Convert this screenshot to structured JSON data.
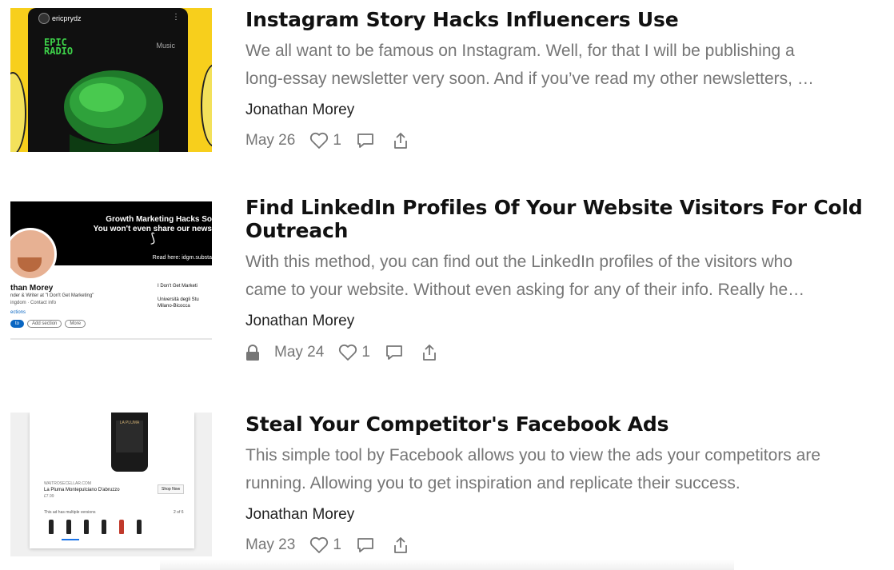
{
  "posts": [
    {
      "title": "Instagram Story Hacks Influencers Use",
      "excerpt_lines": [
        "We all want to be famous on Instagram. Well, for that I will be publishing a",
        "long-essay newsletter very soon. And if you’ve read my other newsletters, …"
      ],
      "author": "Jonathan Morey",
      "date": "May 26",
      "likes": "1",
      "locked": false,
      "thumbnail": {
        "handle": "ericprydz",
        "brand_line1": "EPIC",
        "brand_line2": "RADIO",
        "service": "Music"
      }
    },
    {
      "title_lines": [
        "Find LinkedIn Profiles Of Your Website Visitors For Cold",
        "Outreach"
      ],
      "excerpt_lines": [
        "With this method, you can find out the LinkedIn profiles of the visitors who",
        "came to your website. Without even asking for any of their info. Really he…"
      ],
      "author": "Jonathan Morey",
      "date": "May 24",
      "likes": "1",
      "locked": true,
      "thumbnail": {
        "banner_line1": "Growth Marketing Hacks So",
        "banner_line2": "You won't even share our news",
        "banner_line3": "Read here: idgm.substa",
        "profile_name": "than Morey",
        "profile_sub": "nder & Writer at \"I Don't Get Marketing\"",
        "profile_loc": "ingdom · Contact info",
        "profile_link": "ections",
        "btn_primary": "to",
        "btn_add": "Add section",
        "btn_more": "More",
        "side_company": "I Don't Get Marketi",
        "side_school_1": "Università degli Stu",
        "side_school_2": "Milano-Bicocca"
      }
    },
    {
      "title": "Steal Your Competitor's Facebook Ads",
      "excerpt_lines": [
        "This simple tool by Facebook allows you to view the ads your competitors are",
        "running. Allowing you to get inspiration and replicate their success."
      ],
      "author": "Jonathan Morey",
      "date": "May 23",
      "likes": "1",
      "locked": false,
      "thumbnail": {
        "bottle_label": "LA PLUMA",
        "shop": "WAITROSECELLAR.COM",
        "wine": "La Pluma Montepulciano D'abruzzo",
        "price": "£7.99",
        "shop_now": "Shop Now",
        "variants": "This ad has multiple versions",
        "count": "2 of 6"
      }
    }
  ],
  "icons": {
    "like": "heart-outline-icon",
    "comment": "comment-bubble-icon",
    "share": "share-upload-icon",
    "lock": "padlock-icon"
  },
  "colors": {
    "title": "#111111",
    "excerpt": "#767676",
    "epic_green": "#3ed34a",
    "thumb_yellow": "#f7cf1c",
    "linkedin_blue": "#0a66c2"
  }
}
